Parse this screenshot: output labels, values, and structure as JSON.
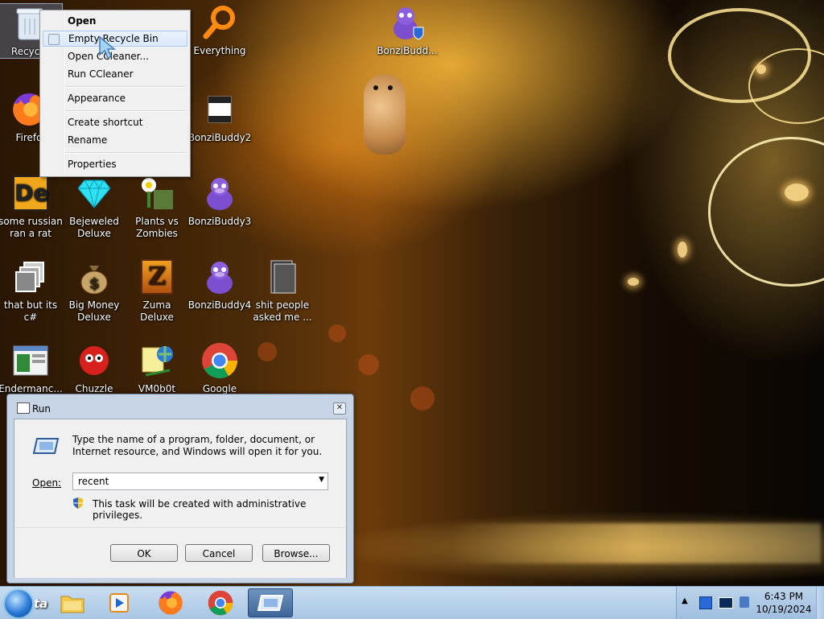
{
  "context_menu": {
    "items": {
      "open": "Open",
      "empty_recycle_bin": "Empty Recycle Bin",
      "open_ccleaner": "Open CCleaner...",
      "run_ccleaner": "Run CCleaner",
      "appearance": "Appearance",
      "create_shortcut": "Create shortcut",
      "rename": "Rename",
      "properties": "Properties"
    }
  },
  "desktop_icons": {
    "recycle_bin": "Recycle",
    "firefox": "Firefo",
    "some_russian": "some russian ran a rat",
    "that_but": "that but its c#",
    "endermanch": "Endermanc...",
    "bejeweled": "Bejeweled Deluxe",
    "big_money": "Big Money Deluxe",
    "chuzzle": "Chuzzle",
    "plants": "Plants vs Zombies",
    "zuma": "Zuma Deluxe",
    "vm0b0t": "VM0b0t",
    "everything": "Everything",
    "bonzi2": "BonziBuddy2",
    "bonzi3": "BonziBuddy3",
    "bonzi4": "BonziBuddy4",
    "google": "Google",
    "shit_people": "shit people asked me ...",
    "bonzi_top": "BonziBudd..."
  },
  "run_dialog": {
    "title": "Run",
    "description": "Type the name of a program, folder, document, or Internet resource, and Windows will open it for you.",
    "open_label": "Open:",
    "open_value": "recent",
    "admin_note": "This task will be created with administrative privileges.",
    "ok": "OK",
    "cancel": "Cancel",
    "browse": "Browse..."
  },
  "taskbar": {
    "start_label": "ta",
    "time": "6:43 PM",
    "date": "10/19/2024"
  },
  "colors": {
    "menu_bg": "#f0f0f0",
    "dialog_frame": "#c7d4e5",
    "taskbar": "#b8d2ea"
  }
}
